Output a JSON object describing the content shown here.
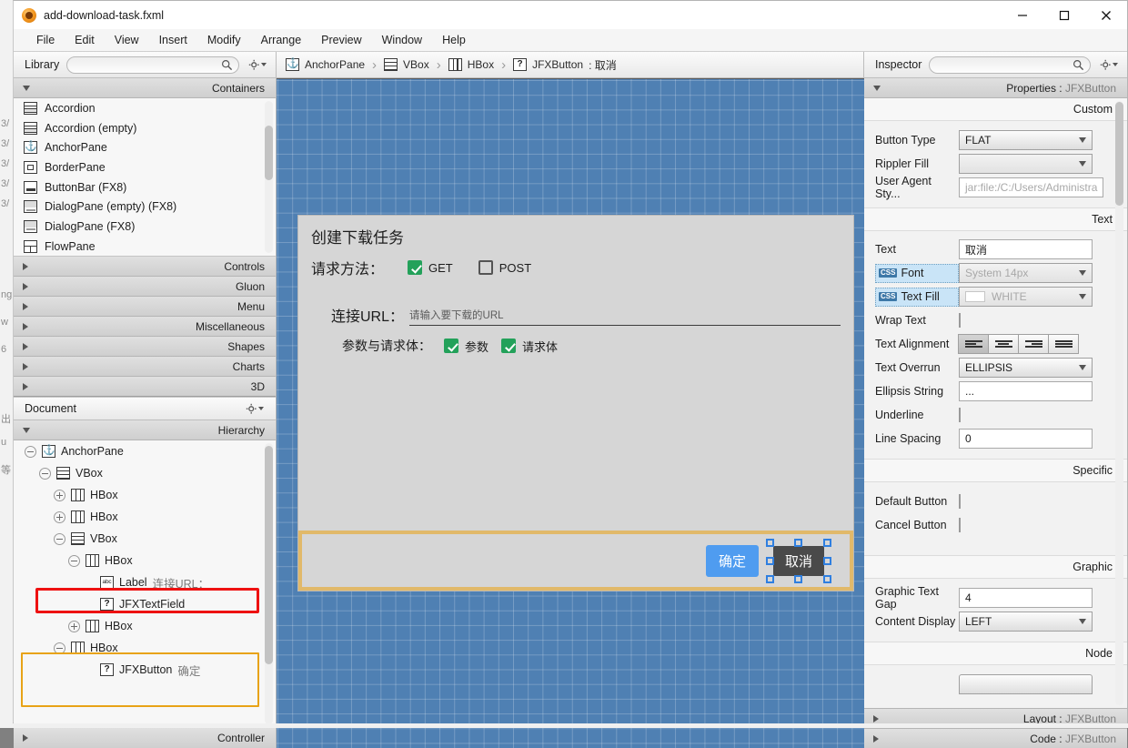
{
  "window": {
    "title": "add-download-task.fxml",
    "icon": "scenebuilder-app-icon",
    "minimize_label": "Minimize",
    "maximize_label": "Maximize",
    "close_label": "Close"
  },
  "menubar": {
    "items": [
      "File",
      "Edit",
      "View",
      "Insert",
      "Modify",
      "Arrange",
      "Preview",
      "Window",
      "Help"
    ]
  },
  "library": {
    "title": "Library",
    "search_placeholder": "",
    "search_value": "",
    "gear_label": "Library settings",
    "sections": [
      {
        "label": "Containers",
        "expanded": true
      },
      {
        "label": "Controls",
        "expanded": false
      },
      {
        "label": "Gluon",
        "expanded": false
      },
      {
        "label": "Menu",
        "expanded": false
      },
      {
        "label": "Miscellaneous",
        "expanded": false
      },
      {
        "label": "Shapes",
        "expanded": false
      },
      {
        "label": "Charts",
        "expanded": false
      },
      {
        "label": "3D",
        "expanded": false
      }
    ],
    "items": [
      {
        "label": "Accordion",
        "icon": "accordion-icon"
      },
      {
        "label": "Accordion  (empty)",
        "icon": "accordion-empty-icon"
      },
      {
        "label": "AnchorPane",
        "icon": "anchorpane-icon"
      },
      {
        "label": "BorderPane",
        "icon": "borderpane-icon"
      },
      {
        "label": "ButtonBar  (FX8)",
        "icon": "buttonbar-icon"
      },
      {
        "label": "DialogPane (empty)  (FX8)",
        "icon": "dialogpane-empty-icon"
      },
      {
        "label": "DialogPane  (FX8)",
        "icon": "dialogpane-icon"
      },
      {
        "label": "FlowPane",
        "icon": "flowpane-icon"
      }
    ]
  },
  "document": {
    "title": "Document",
    "gear_label": "Document settings",
    "hierarchy_label": "Hierarchy",
    "controller_label": "Controller",
    "tree": [
      {
        "label": "AnchorPane",
        "value": "",
        "icon": "anchorpane-icon",
        "indent": 0,
        "expander": "minus",
        "selected": "none"
      },
      {
        "label": "VBox",
        "value": "",
        "icon": "vbox-icon",
        "indent": 1,
        "expander": "minus",
        "selected": "none"
      },
      {
        "label": "HBox",
        "value": "",
        "icon": "hbox-icon",
        "indent": 2,
        "expander": "plus",
        "selected": "none"
      },
      {
        "label": "HBox",
        "value": "",
        "icon": "hbox-icon",
        "indent": 2,
        "expander": "plus",
        "selected": "none"
      },
      {
        "label": "VBox",
        "value": "",
        "icon": "vbox-icon",
        "indent": 2,
        "expander": "minus",
        "selected": "none"
      },
      {
        "label": "HBox",
        "value": "",
        "icon": "hbox-icon",
        "indent": 3,
        "expander": "minus",
        "selected": "none"
      },
      {
        "label": "Label",
        "value": "连接URL：",
        "icon": "label-icon",
        "indent": 4,
        "expander": "none",
        "selected": "none"
      },
      {
        "label": "JFXTextField",
        "value": "",
        "icon": "unknown-icon",
        "indent": 4,
        "expander": "none",
        "selected": "red"
      },
      {
        "label": "HBox",
        "value": "",
        "icon": "hbox-icon",
        "indent": 3,
        "expander": "plus",
        "selected": "none"
      },
      {
        "label": "HBox",
        "value": "",
        "icon": "hbox-icon",
        "indent": 2,
        "expander": "minus",
        "selected": "gold"
      },
      {
        "label": "JFXButton",
        "value": "确定",
        "icon": "unknown-icon",
        "indent": 3,
        "expander": "none",
        "selected": "none"
      }
    ]
  },
  "breadcrumb": {
    "crumbs": [
      {
        "label": "AnchorPane",
        "value": "",
        "icon": "anchorpane-icon"
      },
      {
        "label": "VBox",
        "value": "",
        "icon": "vbox-icon"
      },
      {
        "label": "HBox",
        "value": "",
        "icon": "hbox-icon"
      },
      {
        "label": "JFXButton",
        "value": " : 取消",
        "icon": "unknown-icon"
      }
    ],
    "separator": "›"
  },
  "inspector": {
    "title": "Inspector",
    "search_placeholder": "",
    "search_value": "",
    "gear_label": "Inspector settings",
    "properties_label": "Properties",
    "properties_object": "JFXButton",
    "layout_label": "Layout",
    "layout_object": "JFXButton",
    "code_label": "Code",
    "code_object": "JFXButton",
    "sections": {
      "custom": "Custom",
      "text": "Text",
      "specific": "Specific",
      "graphic": "Graphic",
      "node": "Node"
    },
    "fields": {
      "button_type_label": "Button Type",
      "button_type_value": "FLAT",
      "rippler_fill_label": "Rippler Fill",
      "rippler_fill_value": "",
      "user_agent_label": "User Agent Sty...",
      "user_agent_value": "jar:file:/C:/Users/Administra",
      "text_label": "Text",
      "text_value": "取消",
      "font_label": "Font",
      "font_value": "System 14px",
      "text_fill_label": "Text Fill",
      "text_fill_value": "WHITE",
      "wrap_text_label": "Wrap Text",
      "wrap_text_checked": false,
      "text_alignment_label": "Text Alignment",
      "text_alignment_value": "LEFT",
      "text_overrun_label": "Text Overrun",
      "text_overrun_value": "ELLIPSIS",
      "ellipsis_string_label": "Ellipsis String",
      "ellipsis_string_value": "...",
      "underline_label": "Underline",
      "underline_checked": false,
      "line_spacing_label": "Line Spacing",
      "line_spacing_value": "0",
      "default_button_label": "Default Button",
      "default_button_checked": false,
      "cancel_button_label": "Cancel Button",
      "cancel_button_checked": false,
      "graphic_text_gap_label": "Graphic Text Gap",
      "graphic_text_gap_value": "4",
      "content_display_label": "Content Display",
      "content_display_value": "LEFT"
    }
  },
  "canvas": {
    "dialog": {
      "title": "创建下载任务",
      "method_label": "请求方法：",
      "method_get": "GET",
      "method_get_checked": true,
      "method_post": "POST",
      "method_post_checked": false,
      "url_label": "连接URL：",
      "url_placeholder": "请输入要下载的URL",
      "params_label": "参数与请求体：",
      "params_param": "参数",
      "params_param_checked": true,
      "params_body": "请求体",
      "params_body_checked": true,
      "ok_button": "确定",
      "cancel_button": "取消"
    }
  },
  "colors": {
    "canvas_blue": "#4f80b3",
    "checkbox_green": "#23a15a",
    "ok_button_blue": "#4f9cf0",
    "cancel_button_gray": "#4a4a4a",
    "selection_red": "#ee1111",
    "selection_gold": "#e8a317",
    "handle_blue": "#2f7fe0",
    "css_highlight": "#c9e4f7"
  },
  "bg_window": {
    "fragments": [
      "3/",
      "3/",
      "3/",
      "3/",
      "3/",
      "ng",
      "w",
      "6",
      "出",
      "u",
      "等"
    ]
  }
}
